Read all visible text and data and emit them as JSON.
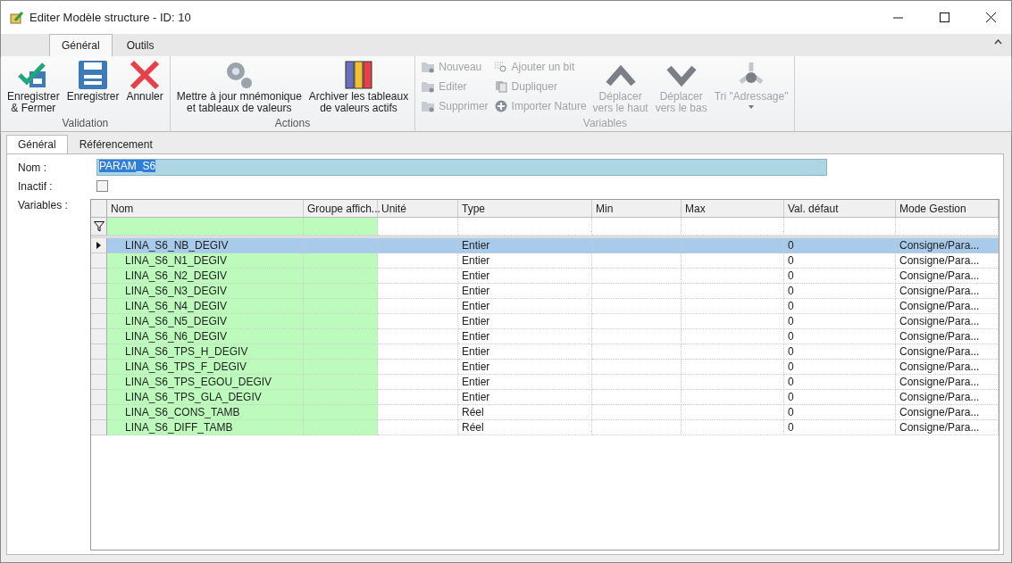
{
  "window": {
    "title": "Editer Modèle structure - ID: 10"
  },
  "ribbon_tabs": [
    {
      "label": "Général",
      "selected": true
    },
    {
      "label": "Outils",
      "selected": false
    }
  ],
  "ribbon_groups": [
    {
      "label": "Validation",
      "buttons": [
        {
          "kind": "large",
          "label": "Enregistrer\n& Fermer",
          "disabled": false
        },
        {
          "kind": "large",
          "label": "Enregistrer",
          "disabled": false
        },
        {
          "kind": "large",
          "label": "Annuler",
          "disabled": false
        }
      ]
    },
    {
      "label": "Actions",
      "buttons": [
        {
          "kind": "large",
          "label": "Mettre à jour mnémonique\net tableaux de valeurs",
          "disabled": false
        },
        {
          "kind": "large",
          "label": "Archiver les tableaux\nde valeurs actifs",
          "disabled": false
        }
      ]
    },
    {
      "label": "Variables",
      "buttons": [
        {
          "kind": "small",
          "label": "Nouveau",
          "disabled": true
        },
        {
          "kind": "small",
          "label": "Editer",
          "disabled": true
        },
        {
          "kind": "small",
          "label": "Supprimer",
          "disabled": true
        },
        {
          "kind": "small",
          "label": "Ajouter un bit",
          "disabled": true
        },
        {
          "kind": "small",
          "label": "Dupliquer",
          "disabled": true
        },
        {
          "kind": "small",
          "label": "Importer Nature",
          "disabled": true
        },
        {
          "kind": "large",
          "label": "Déplacer\nvers le haut",
          "disabled": true
        },
        {
          "kind": "large",
          "label": "Déplacer\nvers le bas",
          "disabled": true
        },
        {
          "kind": "large",
          "label": "Tri \"Adressage\"",
          "disabled": true,
          "dropdown": true
        }
      ]
    }
  ],
  "doc_tabs": [
    {
      "label": "Général",
      "selected": true
    },
    {
      "label": "Référencement",
      "selected": false
    }
  ],
  "form": {
    "name_label": "Nom :",
    "name_value": "PARAM_S6",
    "inactive_label": "Inactif :",
    "inactive_checked": false,
    "variables_label": "Variables :"
  },
  "table": {
    "columns": [
      "Nom",
      "Groupe affich...",
      "Unité",
      "Type",
      "Min",
      "Max",
      "Val. défaut",
      "Mode Gestion"
    ],
    "rows": [
      {
        "selected": true,
        "nom": "LINA_S6_NB_DEGIV",
        "type": "Entier",
        "val": "0",
        "mode": "Consigne/Para..."
      },
      {
        "selected": false,
        "nom": "LINA_S6_N1_DEGIV",
        "type": "Entier",
        "val": "0",
        "mode": "Consigne/Para..."
      },
      {
        "selected": false,
        "nom": "LINA_S6_N2_DEGIV",
        "type": "Entier",
        "val": "0",
        "mode": "Consigne/Para..."
      },
      {
        "selected": false,
        "nom": "LINA_S6_N3_DEGIV",
        "type": "Entier",
        "val": "0",
        "mode": "Consigne/Para..."
      },
      {
        "selected": false,
        "nom": "LINA_S6_N4_DEGIV",
        "type": "Entier",
        "val": "0",
        "mode": "Consigne/Para..."
      },
      {
        "selected": false,
        "nom": "LINA_S6_N5_DEGIV",
        "type": "Entier",
        "val": "0",
        "mode": "Consigne/Para..."
      },
      {
        "selected": false,
        "nom": "LINA_S6_N6_DEGIV",
        "type": "Entier",
        "val": "0",
        "mode": "Consigne/Para..."
      },
      {
        "selected": false,
        "nom": "LINA_S6_TPS_H_DEGIV",
        "type": "Entier",
        "val": "0",
        "mode": "Consigne/Para..."
      },
      {
        "selected": false,
        "nom": "LINA_S6_TPS_F_DEGIV",
        "type": "Entier",
        "val": "0",
        "mode": "Consigne/Para..."
      },
      {
        "selected": false,
        "nom": "LINA_S6_TPS_EGOU_DEGIV",
        "type": "Entier",
        "val": "0",
        "mode": "Consigne/Para..."
      },
      {
        "selected": false,
        "nom": "LINA_S6_TPS_GLA_DEGIV",
        "type": "Entier",
        "val": "0",
        "mode": "Consigne/Para..."
      },
      {
        "selected": false,
        "nom": "LINA_S6_CONS_TAMB",
        "type": "Réel",
        "val": "0",
        "mode": "Consigne/Para..."
      },
      {
        "selected": false,
        "nom": "LINA_S6_DIFF_TAMB",
        "type": "Réel",
        "val": "0",
        "mode": "Consigne/Para..."
      }
    ]
  }
}
